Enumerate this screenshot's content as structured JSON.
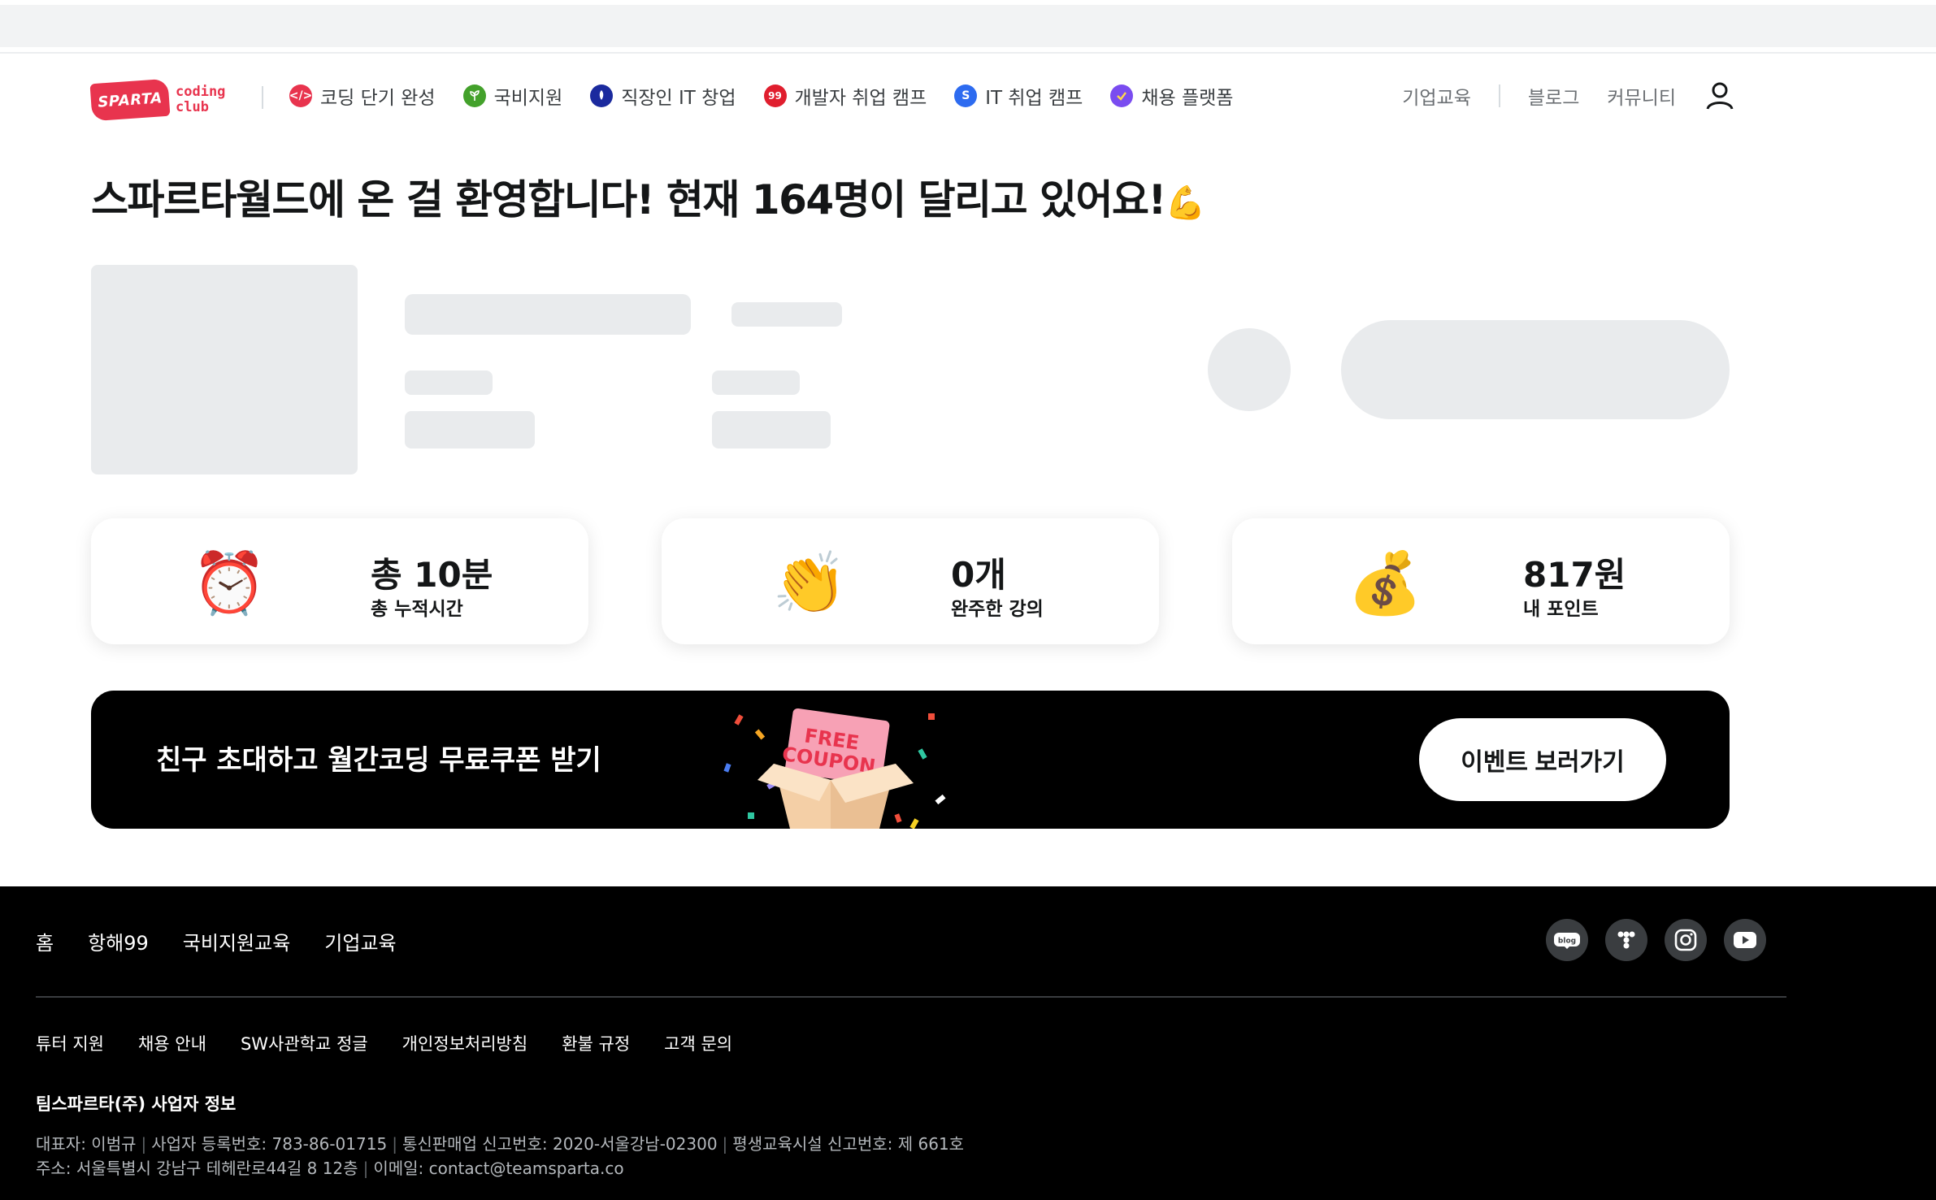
{
  "header": {
    "logo_badge": "SPARTA",
    "logo_text_1": "coding",
    "logo_text_2": "club",
    "nav": [
      {
        "label": "코딩 단기 완성",
        "icon": "code-icon",
        "color": "#e8344e"
      },
      {
        "label": "국비지원",
        "icon": "sprout-icon",
        "color": "#43a12b"
      },
      {
        "label": "직장인 IT 창업",
        "icon": "rocket-icon",
        "color": "#1b2a9e"
      },
      {
        "label": "개발자 취업 캠프",
        "icon": "hanghae99-icon",
        "color": "#e01e2e"
      },
      {
        "label": "IT 취업 캠프",
        "icon": "s-icon",
        "color": "#2d6bf0"
      },
      {
        "label": "채용 플랫폼",
        "icon": "check-icon",
        "color": "#7a4cf0"
      }
    ],
    "right_nav": {
      "corporate": "기업교육",
      "blog": "블로그",
      "community": "커뮤니티"
    }
  },
  "welcome": {
    "text": "스파르타월드에 온 걸 환영합니다! 현재 164명이 달리고 있어요!",
    "emoji": "💪"
  },
  "stats": [
    {
      "icon": "alarm-clock-icon",
      "emoji": "⏰",
      "value": "총 10분",
      "label": "총 누적시간"
    },
    {
      "icon": "clapping-hands-icon",
      "emoji": "👏",
      "value": "0개",
      "label": "완주한 강의"
    },
    {
      "icon": "money-bag-icon",
      "emoji": "💰",
      "value": "817원",
      "label": "내 포인트"
    }
  ],
  "banner": {
    "text": "친구 초대하고 월간코딩 무료쿠폰 받기",
    "coupon_line1": "FREE",
    "coupon_line2": "COUPON",
    "button": "이벤트 보러가기"
  },
  "footer": {
    "nav": [
      "홈",
      "항해99",
      "국비지원교육",
      "기업교육"
    ],
    "links": [
      "튜터 지원",
      "채용 안내",
      "SW사관학교 정글",
      "개인정보처리방침",
      "환불 규정",
      "고객 문의"
    ],
    "company": "팀스파르타(주) 사업자 정보",
    "info_line1": [
      "대표자: 이범규",
      "사업자 등록번호: 783-86-01715",
      "통신판매업 신고번호: 2020-서울강남-02300",
      "평생교육시설 신고번호: 제 661호"
    ],
    "info_line2": [
      "주소: 서울특별시 강남구 테헤란로44길 8 12층",
      "이메일: contact@teamsparta.co"
    ],
    "social_blog_text": "blog"
  }
}
